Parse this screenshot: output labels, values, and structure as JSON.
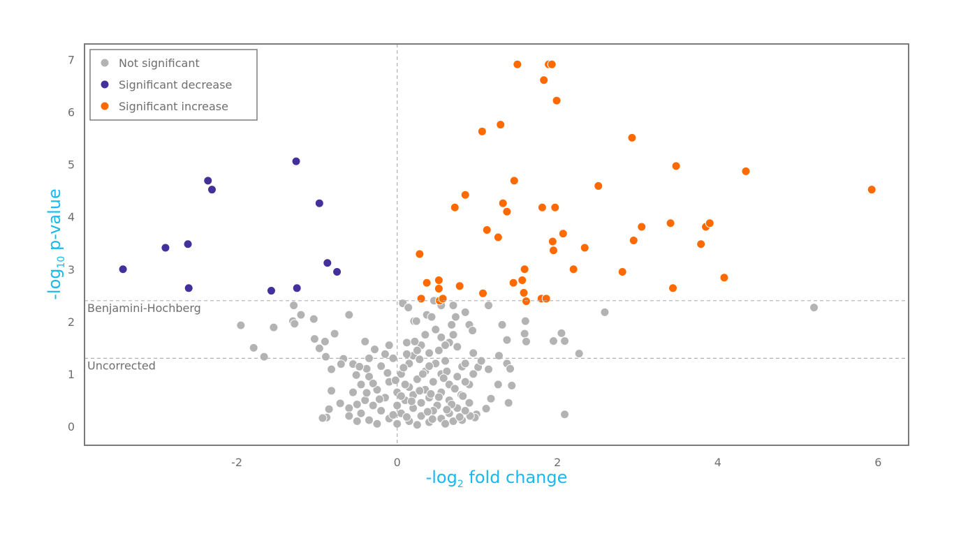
{
  "chart_data": {
    "type": "scatter",
    "title": "",
    "xlabel": {
      "prefix": "-log",
      "subscript": "2",
      "suffix": " fold change"
    },
    "ylabel": {
      "prefix": "-log",
      "subscript": "10",
      "suffix": " p-value"
    },
    "xlim": [
      -3.9,
      6.38
    ],
    "ylim": [
      -0.36,
      7.3
    ],
    "xticks": [
      -2,
      0,
      2,
      4,
      6
    ],
    "yticks": [
      0,
      1,
      2,
      3,
      4,
      5,
      6,
      7
    ],
    "xtick_labels": [
      "-2",
      "0",
      "2",
      "4",
      "6"
    ],
    "ytick_labels": [
      "0",
      "1",
      "2",
      "3",
      "4",
      "5",
      "6",
      "7"
    ],
    "grid": false,
    "legend_position": "top-left",
    "reference_lines": {
      "vertical": {
        "x": 0
      },
      "horizontal": [
        {
          "name": "Benjamini-Hochberg",
          "y": 2.4
        },
        {
          "name": "Uncorrected",
          "y": 1.3
        }
      ]
    },
    "colors": {
      "not_significant": "#b3b3b3",
      "significant_decrease": "#43309a",
      "significant_increase": "#ff6a00",
      "axis_title": "#1ab8ee",
      "frame": "#7a7a7a"
    },
    "series": [
      {
        "name": "Not significant",
        "key": "not_significant",
        "points": [
          [
            -1.95,
            1.93
          ],
          [
            -1.54,
            1.89
          ],
          [
            -1.79,
            1.5
          ],
          [
            -1.66,
            1.33
          ],
          [
            -1.29,
            2.31
          ],
          [
            -1.2,
            2.13
          ],
          [
            -1.3,
            2.01
          ],
          [
            -1.28,
            1.96
          ],
          [
            -1.04,
            2.05
          ],
          [
            -0.6,
            2.13
          ],
          [
            -1.03,
            1.67
          ],
          [
            -0.9,
            1.62
          ],
          [
            -0.97,
            1.49
          ],
          [
            -0.78,
            1.77
          ],
          [
            -0.89,
            1.33
          ],
          [
            -0.82,
            1.09
          ],
          [
            -0.67,
            1.29
          ],
          [
            -0.7,
            1.19
          ],
          [
            -0.38,
            1.1
          ],
          [
            -0.55,
            1.19
          ],
          [
            -0.51,
            0.98
          ],
          [
            -0.47,
            1.14
          ],
          [
            -0.82,
            0.68
          ],
          [
            -0.85,
            0.33
          ],
          [
            -0.88,
            0.17
          ],
          [
            -0.71,
            0.44
          ],
          [
            -0.93,
            0.16
          ],
          [
            0.07,
            2.35
          ],
          [
            0.14,
            2.27
          ],
          [
            0.46,
            2.4
          ],
          [
            0.55,
            2.31
          ],
          [
            0.7,
            2.31
          ],
          [
            1.14,
            2.31
          ],
          [
            0.85,
            2.18
          ],
          [
            0.73,
            2.09
          ],
          [
            0.37,
            2.13
          ],
          [
            0.21,
            2.01
          ],
          [
            0.24,
            2.01
          ],
          [
            0.43,
            2.09
          ],
          [
            0.68,
            1.94
          ],
          [
            0.9,
            1.94
          ],
          [
            0.94,
            1.83
          ],
          [
            1.31,
            1.94
          ],
          [
            1.37,
            1.65
          ],
          [
            1.59,
            1.77
          ],
          [
            1.61,
            1.62
          ],
          [
            1.6,
            2.01
          ],
          [
            2.05,
            1.78
          ],
          [
            2.09,
            1.63
          ],
          [
            2.27,
            1.39
          ],
          [
            1.37,
            1.2
          ],
          [
            1.27,
            1.35
          ],
          [
            1.41,
            1.1
          ],
          [
            1.14,
            1.09
          ],
          [
            1.01,
            1.13
          ],
          [
            0.81,
            1.14
          ],
          [
            1.17,
            0.53
          ],
          [
            1.26,
            0.8
          ],
          [
            1.43,
            0.78
          ],
          [
            1.39,
            0.45
          ],
          [
            1.11,
            0.34
          ],
          [
            0.99,
            0.23
          ],
          [
            0.97,
            0.17
          ],
          [
            0.81,
            0.12
          ],
          [
            0.91,
            0.2
          ],
          [
            2.09,
            0.23
          ],
          [
            5.2,
            2.27
          ],
          [
            2.59,
            2.18
          ],
          [
            1.95,
            1.63
          ],
          [
            0.3,
            1.55
          ],
          [
            0.52,
            1.45
          ],
          [
            0.12,
            1.6
          ],
          [
            -0.1,
            1.55
          ],
          [
            -0.28,
            1.47
          ],
          [
            -0.4,
            1.62
          ],
          [
            0.65,
            1.6
          ],
          [
            0.75,
            1.52
          ],
          [
            0.4,
            1.4
          ],
          [
            0.2,
            1.35
          ],
          [
            -0.05,
            1.3
          ],
          [
            0.95,
            1.4
          ],
          [
            1.05,
            1.25
          ],
          [
            0.6,
            1.25
          ],
          [
            0.85,
            1.2
          ],
          [
            0.15,
            1.2
          ],
          [
            -0.2,
            1.15
          ],
          [
            0.35,
            1.05
          ],
          [
            0.55,
            1.0
          ],
          [
            0.75,
            0.95
          ],
          [
            0.05,
            1.0
          ],
          [
            -0.35,
            0.95
          ],
          [
            0.25,
            0.9
          ],
          [
            0.45,
            0.85
          ],
          [
            0.65,
            0.8
          ],
          [
            0.9,
            0.8
          ],
          [
            -0.1,
            0.85
          ],
          [
            -0.45,
            0.8
          ],
          [
            0.15,
            0.75
          ],
          [
            0.35,
            0.7
          ],
          [
            0.55,
            0.65
          ],
          [
            0.8,
            0.6
          ],
          [
            -0.25,
            0.7
          ],
          [
            -0.55,
            0.65
          ],
          [
            0.0,
            0.65
          ],
          [
            0.2,
            0.6
          ],
          [
            0.4,
            0.55
          ],
          [
            0.65,
            0.5
          ],
          [
            0.9,
            0.45
          ],
          [
            -0.15,
            0.55
          ],
          [
            -0.4,
            0.5
          ],
          [
            0.1,
            0.5
          ],
          [
            0.3,
            0.45
          ],
          [
            0.5,
            0.4
          ],
          [
            0.75,
            0.35
          ],
          [
            -0.3,
            0.4
          ],
          [
            -0.6,
            0.35
          ],
          [
            0.0,
            0.4
          ],
          [
            0.2,
            0.35
          ],
          [
            0.45,
            0.3
          ],
          [
            0.65,
            0.25
          ],
          [
            0.85,
            0.3
          ],
          [
            -0.2,
            0.3
          ],
          [
            -0.45,
            0.25
          ],
          [
            0.05,
            0.25
          ],
          [
            0.3,
            0.2
          ],
          [
            0.55,
            0.15
          ],
          [
            0.7,
            0.1
          ],
          [
            -0.1,
            0.15
          ],
          [
            -0.35,
            0.12
          ],
          [
            0.15,
            0.1
          ],
          [
            0.4,
            0.08
          ],
          [
            0.6,
            0.05
          ],
          [
            -0.25,
            0.05
          ],
          [
            0.0,
            0.05
          ],
          [
            0.25,
            0.03
          ],
          [
            -0.5,
            0.1
          ],
          [
            -0.6,
            0.2
          ],
          [
            0.1,
            0.8
          ],
          [
            0.32,
            1.0
          ],
          [
            0.48,
            1.2
          ],
          [
            0.62,
            1.05
          ],
          [
            0.28,
            1.28
          ],
          [
            0.08,
            1.12
          ],
          [
            -0.12,
            1.02
          ],
          [
            0.42,
            0.62
          ],
          [
            0.58,
            0.92
          ],
          [
            0.72,
            0.72
          ],
          [
            0.18,
            0.48
          ],
          [
            0.38,
            0.28
          ],
          [
            -0.05,
            0.22
          ],
          [
            -0.22,
            0.52
          ],
          [
            -0.38,
            0.64
          ],
          [
            0.52,
            0.56
          ],
          [
            0.68,
            0.42
          ],
          [
            0.82,
            0.58
          ],
          [
            0.25,
            1.45
          ],
          [
            0.12,
            1.38
          ],
          [
            0.55,
            1.7
          ],
          [
            0.7,
            1.75
          ],
          [
            0.35,
            1.75
          ],
          [
            0.48,
            1.85
          ],
          [
            0.6,
            1.55
          ],
          [
            0.22,
            1.62
          ],
          [
            -0.35,
            1.3
          ],
          [
            -0.15,
            1.38
          ],
          [
            0.95,
            1.0
          ],
          [
            0.85,
            0.85
          ],
          [
            0.4,
            1.15
          ],
          [
            -0.02,
            0.88
          ],
          [
            0.05,
            0.58
          ],
          [
            0.28,
            0.68
          ],
          [
            -0.3,
            0.82
          ],
          [
            -0.5,
            0.42
          ],
          [
            0.62,
            0.32
          ],
          [
            0.78,
            0.18
          ],
          [
            0.44,
            0.14
          ],
          [
            0.12,
            0.18
          ]
        ]
      },
      {
        "name": "Significant decrease",
        "key": "significant_decrease",
        "points": [
          [
            -3.42,
            3.0
          ],
          [
            -2.89,
            3.41
          ],
          [
            -2.61,
            3.48
          ],
          [
            -2.36,
            4.69
          ],
          [
            -2.31,
            4.52
          ],
          [
            -2.6,
            2.64
          ],
          [
            -1.57,
            2.59
          ],
          [
            -1.25,
            2.64
          ],
          [
            -0.97,
            4.26
          ],
          [
            -0.87,
            3.12
          ],
          [
            -0.75,
            2.95
          ],
          [
            -1.26,
            5.06
          ]
        ]
      },
      {
        "name": "Significant increase",
        "key": "significant_increase",
        "points": [
          [
            1.5,
            6.91
          ],
          [
            1.89,
            6.91
          ],
          [
            1.93,
            6.91
          ],
          [
            1.83,
            6.61
          ],
          [
            1.99,
            6.22
          ],
          [
            1.29,
            5.76
          ],
          [
            1.06,
            5.63
          ],
          [
            2.93,
            5.51
          ],
          [
            3.48,
            4.97
          ],
          [
            4.35,
            4.87
          ],
          [
            1.46,
            4.69
          ],
          [
            2.51,
            4.59
          ],
          [
            5.92,
            4.52
          ],
          [
            0.85,
            4.42
          ],
          [
            0.72,
            4.18
          ],
          [
            1.32,
            4.26
          ],
          [
            1.37,
            4.1
          ],
          [
            1.81,
            4.18
          ],
          [
            1.97,
            4.18
          ],
          [
            3.05,
            3.81
          ],
          [
            3.41,
            3.88
          ],
          [
            3.85,
            3.81
          ],
          [
            3.9,
            3.88
          ],
          [
            1.12,
            3.75
          ],
          [
            1.26,
            3.61
          ],
          [
            2.07,
            3.68
          ],
          [
            1.94,
            3.53
          ],
          [
            2.95,
            3.55
          ],
          [
            1.95,
            3.36
          ],
          [
            2.34,
            3.41
          ],
          [
            3.79,
            3.48
          ],
          [
            0.28,
            3.29
          ],
          [
            1.59,
            3.0
          ],
          [
            2.2,
            3.0
          ],
          [
            2.81,
            2.95
          ],
          [
            4.08,
            2.84
          ],
          [
            0.37,
            2.74
          ],
          [
            0.52,
            2.79
          ],
          [
            0.52,
            2.63
          ],
          [
            0.78,
            2.68
          ],
          [
            1.45,
            2.74
          ],
          [
            1.56,
            2.79
          ],
          [
            3.44,
            2.64
          ],
          [
            1.07,
            2.54
          ],
          [
            1.58,
            2.55
          ],
          [
            1.61,
            2.39
          ],
          [
            0.3,
            2.44
          ],
          [
            0.53,
            2.4
          ],
          [
            0.57,
            2.44
          ],
          [
            1.8,
            2.44
          ],
          [
            1.86,
            2.44
          ]
        ]
      }
    ]
  }
}
